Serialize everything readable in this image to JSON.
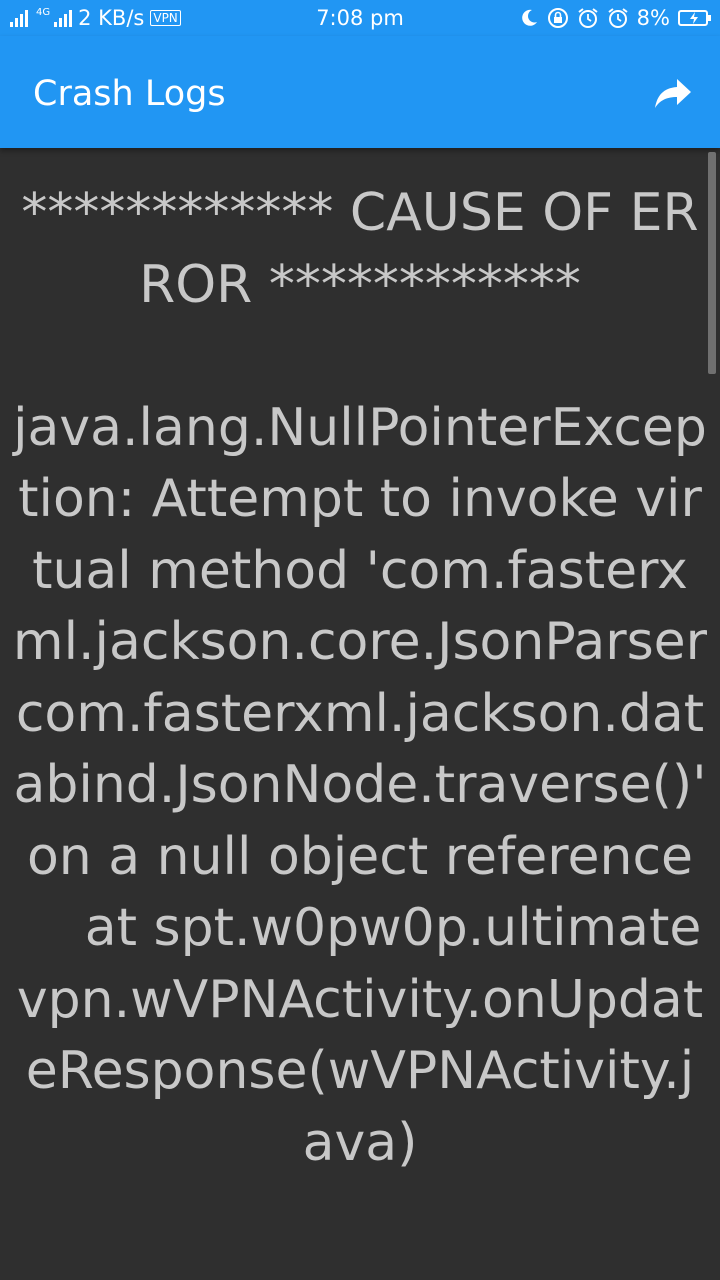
{
  "status_bar": {
    "network_type": "4G",
    "net_speed": "2 KB/s",
    "vpn_label": "VPN",
    "time": "7:08 pm",
    "battery_percent": "8%",
    "icons": [
      "signal-icon",
      "vpn-icon",
      "moon-icon",
      "lock-rotation-icon",
      "alarm-icon",
      "alarm-icon",
      "battery-charging-icon"
    ]
  },
  "app_bar": {
    "title": "Crash Logs",
    "share_icon": "share-icon",
    "background_color": "#2196f3"
  },
  "log": {
    "text": "************ CAUSE OF ERROR ************\n\njava.lang.NullPointerException: Attempt to invoke virtual method 'com.fasterxml.jackson.core.JsonParser com.fasterxml.jackson.databind.JsonNode.traverse()' on a null object reference\n    at spt.w0pw0p.ultimatevpn.wVPNActivity.onUpdateResponse(wVPNActivity.java)",
    "text_color": "#c8c8c8",
    "background_color": "#2f2f2f"
  }
}
